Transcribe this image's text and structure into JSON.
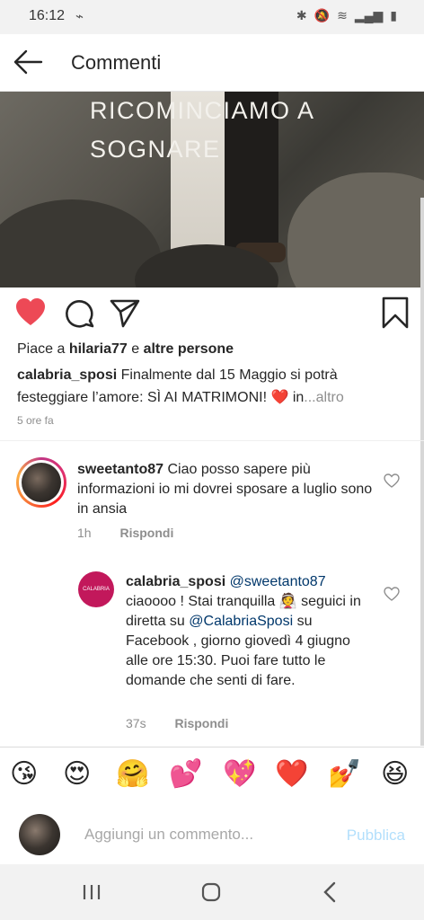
{
  "status_bar": {
    "time": "16:12"
  },
  "header": {
    "title": "Commenti"
  },
  "post": {
    "overlay_text": "RICOMINCIAMO A SOGNARE",
    "likes_prefix": "Piace a",
    "likes_user": "hilaria77",
    "likes_conj": "e",
    "likes_rest": "altre persone",
    "caption_user": "calabria_sposi",
    "caption_text": "Finalmente dal 15 Maggio si potrà festeggiare l’amore: SÌ AI MATRIMONI! ❤️ in",
    "caption_more": "...altro",
    "time": "5 ore fa"
  },
  "comments": [
    {
      "user": "sweetanto87",
      "text": "Ciao posso sapere più informazioni io mi dovrei sposare a luglio sono in ansia",
      "time": "1h",
      "reply_label": "Rispondi"
    },
    {
      "user": "calabria_sposi",
      "mention": "@sweetanto87",
      "text_1": "ciaoooo ! Stai tranquilla 👰 seguici in diretta su",
      "mention_2": "@CalabriaSposi",
      "text_2": "su Facebook , giorno giovedì 4 giugno alle ore 15:30. Puoi fare tutto le domande che senti di fare.",
      "time": "37s",
      "reply_label": "Rispondi",
      "avatar_text": "CALABRIA SPOSI"
    }
  ],
  "emoji_bar": [
    "😘",
    "😍",
    "🤗",
    "💕",
    "💖",
    "❤️",
    "💅",
    "😆"
  ],
  "composer": {
    "placeholder": "Aggiungi un commento...",
    "publish_label": "Pubblica"
  },
  "colors": {
    "like_red": "#ed4956",
    "link_blue": "#00376b",
    "publish_disabled": "#b2dffc"
  }
}
